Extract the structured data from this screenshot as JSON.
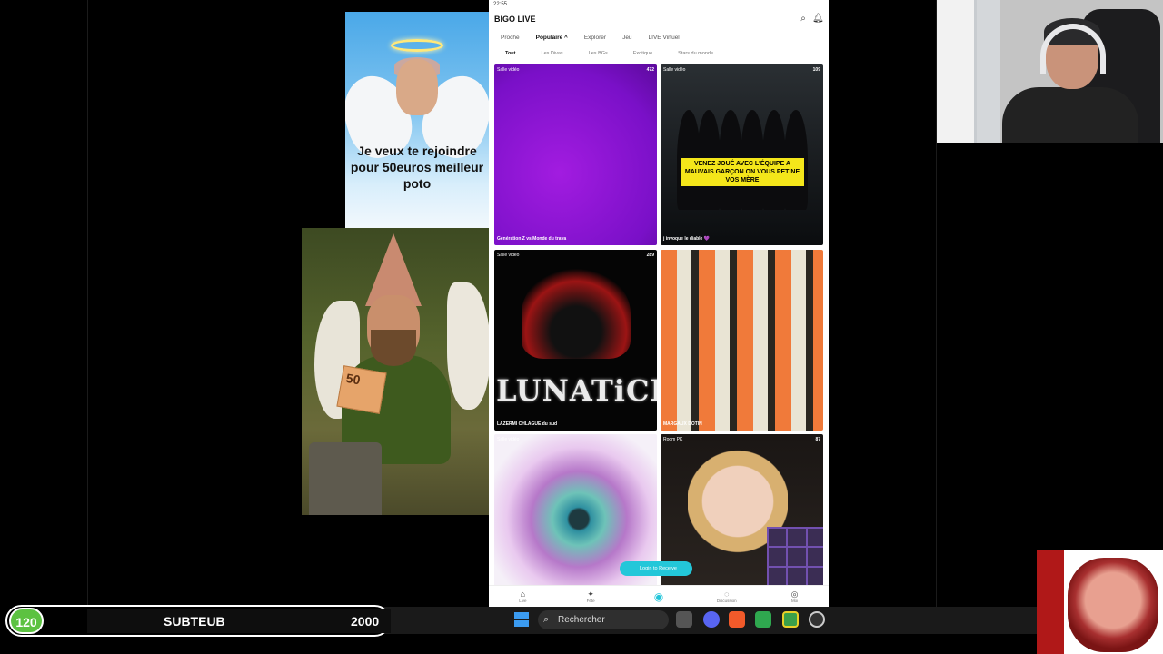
{
  "overlays": {
    "angel_caption": "Je veux te rejoindre pour 50euros meilleur poto",
    "bill_value": "50"
  },
  "phone": {
    "status_time": "22:55",
    "app_name": "BIGO LIVE",
    "tabs": [
      {
        "label": "Proche",
        "active": false
      },
      {
        "label": "Populaire ^",
        "active": true
      },
      {
        "label": "Explorer",
        "active": false
      },
      {
        "label": "Jeu",
        "active": false
      },
      {
        "label": "LIVE Virtuel",
        "active": false
      }
    ],
    "subtabs": [
      {
        "label": "Tout",
        "active": true
      },
      {
        "label": "Les Divas",
        "active": false
      },
      {
        "label": "Les BGs",
        "active": false
      },
      {
        "label": "Exotique",
        "active": false
      },
      {
        "label": "Stars du monde",
        "active": false
      }
    ],
    "cards": [
      {
        "tag": "Salle vidéo",
        "count": "472",
        "title": "Génération Z vs Monde du trava"
      },
      {
        "tag": "Salle vidéo",
        "count": "109",
        "title": "j invoque le diable 💜",
        "banner": "VENEZ JOUÉ AVEC L'ÉQUIPE A MAUVAIS GARÇON ON VOUS PETINE VOS MÈRE"
      },
      {
        "tag": "Salle vidéo",
        "count": "289",
        "title": "LAZERMI CHLAGUE du sud",
        "logo": "LUNATiCK"
      },
      {
        "tag": "",
        "count": "",
        "title": "MARGAUX DOTIN"
      },
      {
        "tag": "Salle vidéo",
        "count": "",
        "title": ""
      },
      {
        "tag": "Room PK",
        "count": "87",
        "title": ""
      }
    ],
    "banner_pill": "Login to Receive",
    "nav": [
      "Live",
      "Fête",
      "",
      "Discussion",
      "Moi"
    ]
  },
  "sub_goal": {
    "current": "120",
    "label": "SUBTEUB",
    "goal": "2000"
  },
  "taskbar": {
    "search_placeholder": "Rechercher"
  }
}
